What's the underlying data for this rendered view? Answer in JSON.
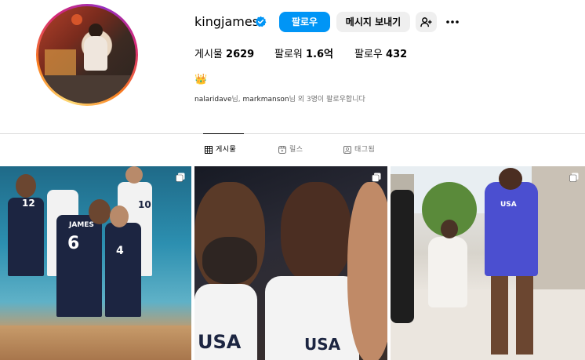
{
  "profile": {
    "username": "kingjames",
    "follow_label": "팔로우",
    "message_label": "메시지 보내기",
    "posts_label": "게시물",
    "posts_count": "2629",
    "followers_label": "팔로워",
    "followers_count": "1.6억",
    "following_label": "팔로우",
    "following_count": "432",
    "bio_emoji": "👑",
    "followed_by_name1": "nalaridave",
    "followed_by_mid": "님, ",
    "followed_by_name2": "markmanson",
    "followed_by_suffix": "님 외 3명이 팔로우합니다"
  },
  "tabs": [
    {
      "label": "게시물",
      "icon": "grid-icon"
    },
    {
      "label": "릴스",
      "icon": "reels-icon"
    },
    {
      "label": "태그됨",
      "icon": "tagged-icon"
    }
  ],
  "posts": [
    {
      "desc_text_1": "JAMES",
      "desc_num_1": "6",
      "desc_num_2": "4",
      "desc_num_3": "12",
      "desc_num_4": "10",
      "multi": true
    },
    {
      "desc_text_1": "USA",
      "desc_text_2": "USA",
      "multi": true
    },
    {
      "desc_text_1": "USA",
      "multi": true
    }
  ],
  "colors": {
    "accent": "#0095f6",
    "secondary_button": "#efefef",
    "muted_text": "#737373",
    "divider": "#dbdbdb"
  }
}
